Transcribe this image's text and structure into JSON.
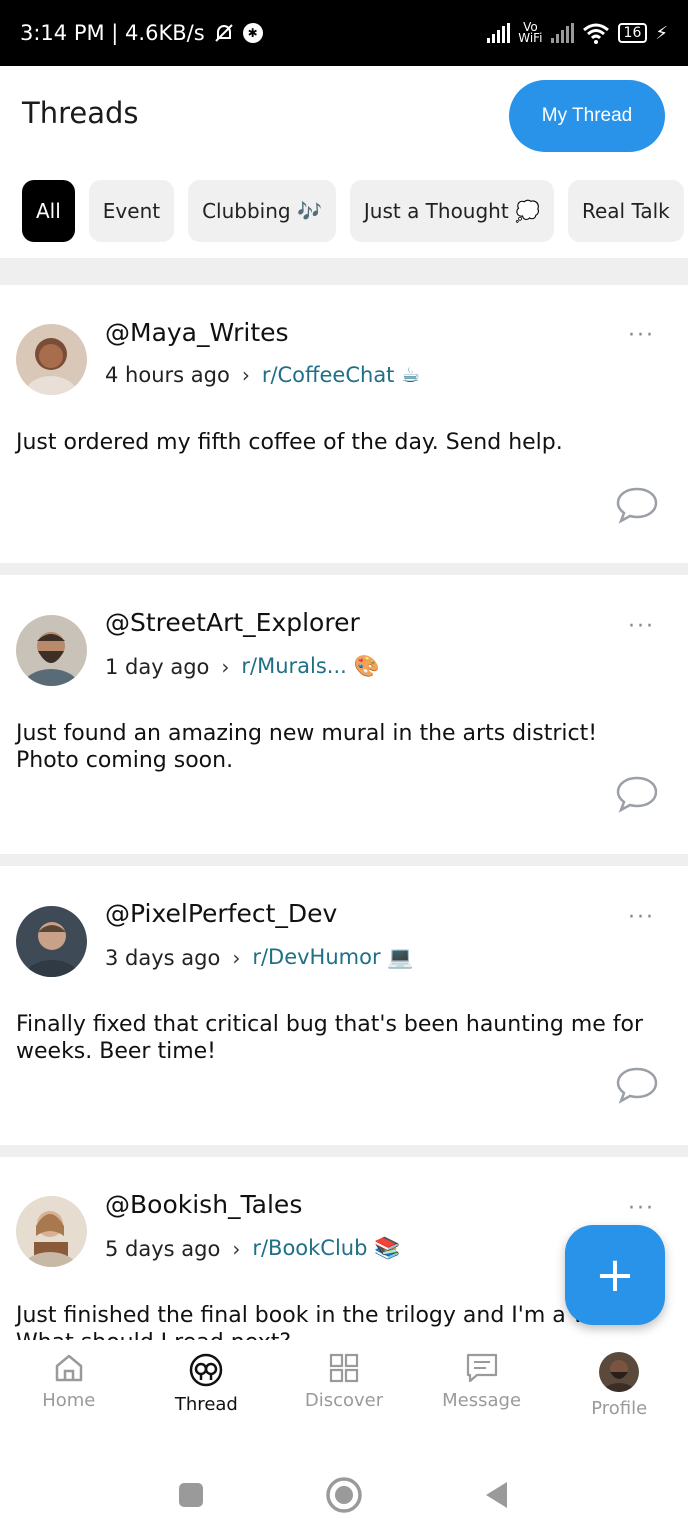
{
  "status_bar": {
    "left_text": "3:14 PM | 4.6KB/s",
    "vo_label": "Vo",
    "wifi_label": "WiFi",
    "battery": "16"
  },
  "header": {
    "title": "Threads",
    "my_thread_label": "My Thread"
  },
  "filters": [
    {
      "label": "All",
      "active": true
    },
    {
      "label": "Event",
      "active": false
    },
    {
      "label": "Clubbing 🎶",
      "active": false
    },
    {
      "label": "Just a Thought 💭",
      "active": false
    },
    {
      "label": "Real Talk",
      "active": false
    }
  ],
  "posts": [
    {
      "username": "@Maya_Writes",
      "time": "4 hours ago",
      "subreddit": "r/CoffeeChat ☕",
      "text": "Just ordered my fifth coffee of the day. Send help.",
      "avatar_color": "#6b4a3a"
    },
    {
      "username": "@StreetArt_Explorer",
      "time": "1 day ago",
      "subreddit": "r/Murals... 🎨",
      "text": "Just found an amazing new mural in the arts district! Photo coming soon.",
      "avatar_color": "#7a6a5c"
    },
    {
      "username": "@PixelPerfect_Dev",
      "time": "3 days ago",
      "subreddit": "r/DevHumor 💻",
      "text": "Finally fixed that critical bug that's been haunting me for weeks. Beer time!",
      "avatar_color": "#4a5866"
    },
    {
      "username": "@Bookish_Tales",
      "time": "5 days ago",
      "subreddit": "r/BookClub 📚",
      "text": "Just finished the final book in the trilogy and I'm a wr",
      "text2": "What should I read next?",
      "avatar_color": "#b08a6a"
    }
  ],
  "fab_label": "+",
  "nav": [
    {
      "label": "Home",
      "icon": "home-icon"
    },
    {
      "label": "Thread",
      "icon": "thread-icon"
    },
    {
      "label": "Discover",
      "icon": "discover-icon"
    },
    {
      "label": "Message",
      "icon": "message-icon"
    },
    {
      "label": "Profile",
      "icon": "profile-avatar"
    }
  ],
  "colors": {
    "accent": "#2893e8",
    "subreddit": "#1f6f86"
  }
}
